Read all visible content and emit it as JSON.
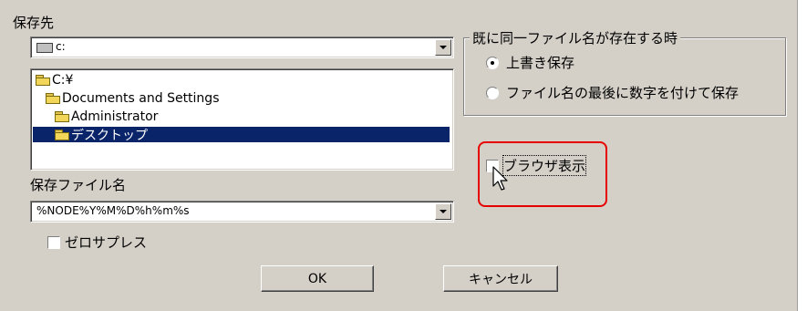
{
  "save_location": {
    "label": "保存先",
    "drive_value": "c:",
    "folders": [
      {
        "label": "C:¥"
      },
      {
        "label": "Documents and Settings"
      },
      {
        "label": "Administrator"
      },
      {
        "label": "デスクトップ",
        "selected": true
      }
    ]
  },
  "file_name": {
    "label": "保存ファイル名",
    "value": "%NODE%Y%M%D%h%m%s"
  },
  "zero_suppress": {
    "label": "ゼロサプレス",
    "checked": false
  },
  "overwrite_group": {
    "title": "既に同一ファイル名が存在する時",
    "options": [
      {
        "label": "上書き保存",
        "selected": true
      },
      {
        "label": "ファイル名の最後に数字を付けて保存",
        "selected": false
      }
    ]
  },
  "browser_view": {
    "label": "ブラウザ表示",
    "checked": false
  },
  "buttons": {
    "ok": "OK",
    "cancel": "キャンセル"
  }
}
